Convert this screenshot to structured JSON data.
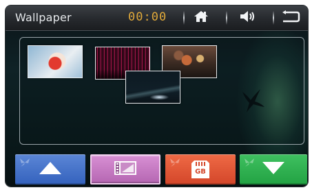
{
  "header": {
    "title": "Wallpaper",
    "clock": "00:00",
    "icons": [
      "home-icon",
      "volume-icon",
      "back-icon"
    ]
  },
  "gallery": {
    "thumbnails": [
      "wallpaper-thumbnail-1",
      "wallpaper-thumbnail-2",
      "wallpaper-thumbnail-3",
      "wallpaper-thumbnail-4"
    ]
  },
  "bottom_buttons": {
    "up": "up-arrow-icon",
    "video": "video-icon",
    "sd_card": "sd-card-icon",
    "down": "down-arrow-icon",
    "sd_card_label": "GB"
  },
  "colors": {
    "clock": "#e0a93a",
    "up_button": "#3462bd",
    "video_button": "#b566b2",
    "sd_button": "#d3462a",
    "down_button": "#22a243"
  }
}
